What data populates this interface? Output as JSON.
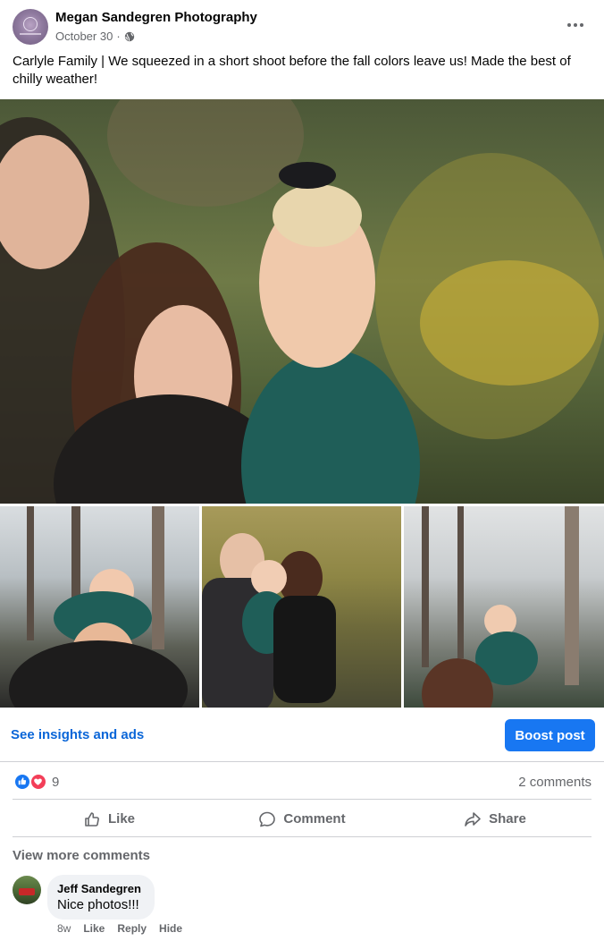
{
  "post": {
    "page_name": "Megan Sandegren Photography",
    "date": "October 30",
    "separator": "·",
    "privacy_icon": "globe-icon",
    "more_icon": "more-options-icon",
    "caption": "Carlyle Family | We squeezed in a short shoot before the fall colors leave us! Made the best of chilly weather!"
  },
  "insights": {
    "link_label": "See insights and ads",
    "boost_label": "Boost post"
  },
  "reactions": {
    "icons": [
      "like-reaction-icon",
      "love-reaction-icon"
    ],
    "count": "9",
    "comments_count": "2 comments"
  },
  "actions": {
    "like_label": "Like",
    "comment_label": "Comment",
    "share_label": "Share"
  },
  "comments": {
    "view_more_label": "View more comments",
    "items": [
      {
        "author": "Jeff Sandegren",
        "text": "Nice photos!!!",
        "age": "8w",
        "like_label": "Like",
        "reply_label": "Reply",
        "hide_label": "Hide"
      }
    ]
  },
  "colors": {
    "accent": "#1877f2",
    "link": "#0a66d8",
    "secondary_text": "#65676b",
    "divider": "#ced0d4",
    "love": "#f33e58"
  }
}
